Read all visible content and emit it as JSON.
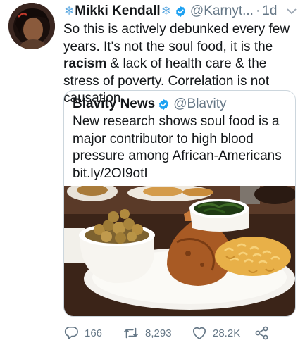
{
  "tweet": {
    "author_name": "Mikki Kendall",
    "handle": "@Karnyt...",
    "separator": "·",
    "time": "1d",
    "text_1": "So this is actively debunked every few years. It's not the soul food, it is the ",
    "text_bold": "racism",
    "text_2": " & lack of health care & the stress of poverty. Correlation is not causation."
  },
  "quoted": {
    "author_name": "Blavity News",
    "handle": "@Blavity",
    "text": "New research shows soul food is a major contributor to high blood pressure among African-Americans bit.ly/2OI9otI"
  },
  "actions": {
    "replies": "166",
    "retweets": "8,293",
    "likes": "28.2K"
  },
  "colors": {
    "accent": "#1da1f2",
    "snowflake": "#5aa7e0",
    "muted_text": "#657786",
    "border": "#ccd6dd"
  },
  "icons": {
    "author_decor": "snowflake-icon",
    "verified": "verified-badge-icon",
    "menu": "chevron-down-icon",
    "reply": "reply-icon",
    "retweet": "retweet-icon",
    "like": "heart-icon",
    "share": "share-icon"
  }
}
